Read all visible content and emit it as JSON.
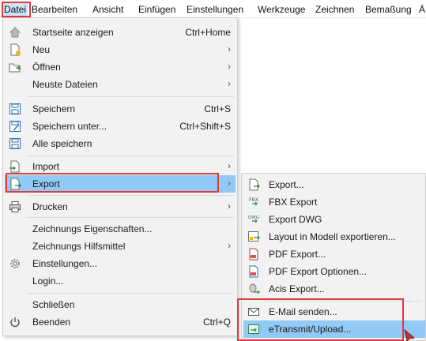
{
  "menubar": {
    "items": [
      "Datei",
      "Bearbeiten",
      "Ansicht",
      "Einfügen",
      "Einstellungen",
      "Werkzeuge",
      "Zeichnen",
      "Bemaßung",
      "Ä"
    ]
  },
  "file_menu": {
    "items": [
      {
        "label": "Startseite anzeigen",
        "shortcut": "Ctrl+Home",
        "icon": "home-icon"
      },
      {
        "label": "Neu",
        "icon": "new-file-icon",
        "submenu": true
      },
      {
        "label": "Öffnen",
        "icon": "open-folder-icon",
        "submenu": true
      },
      {
        "label": "Neuste Dateien",
        "submenu": true
      },
      {
        "label": "Speichern",
        "shortcut": "Ctrl+S",
        "icon": "save-icon"
      },
      {
        "label": "Speichern unter...",
        "shortcut": "Ctrl+Shift+S",
        "icon": "save-as-icon"
      },
      {
        "label": "Alle speichern",
        "icon": "save-all-icon"
      },
      {
        "label": "Import",
        "icon": "import-icon",
        "submenu": true
      },
      {
        "label": "Export",
        "icon": "export-icon",
        "submenu": true,
        "highlighted": true
      },
      {
        "label": "Drucken",
        "icon": "printer-icon",
        "submenu": true
      },
      {
        "label": "Zeichnungs Eigenschaften..."
      },
      {
        "label": "Zeichnungs Hilfsmittel",
        "submenu": true
      },
      {
        "label": "Einstellungen...",
        "icon": "gear-icon"
      },
      {
        "label": "Login..."
      },
      {
        "label": "Schließen"
      },
      {
        "label": "Beenden",
        "shortcut": "Ctrl+Q",
        "icon": "power-icon"
      }
    ]
  },
  "export_submenu": {
    "items": [
      {
        "label": "Export...",
        "icon": "export-file-icon"
      },
      {
        "label": "FBX Export",
        "icon": "fbx-icon",
        "icon_text": "FBX"
      },
      {
        "label": "Export DWG",
        "icon": "dwg-icon",
        "icon_text": "DWG"
      },
      {
        "label": "Layout in Modell exportieren...",
        "icon": "layout-export-icon"
      },
      {
        "label": "PDF Export...",
        "icon": "pdf-icon"
      },
      {
        "label": "PDF Export Optionen...",
        "icon": "pdf-options-icon"
      },
      {
        "label": "Acis Export...",
        "icon": "acis-icon"
      },
      {
        "label": "E-Mail senden...",
        "icon": "email-icon"
      },
      {
        "label": "eTransmit/Upload...",
        "icon": "etransmit-icon",
        "highlighted": true
      }
    ]
  },
  "colors": {
    "highlight": "#91c9f7",
    "annotation_red": "#e0393e",
    "menu_bg": "#f2f2f2"
  }
}
